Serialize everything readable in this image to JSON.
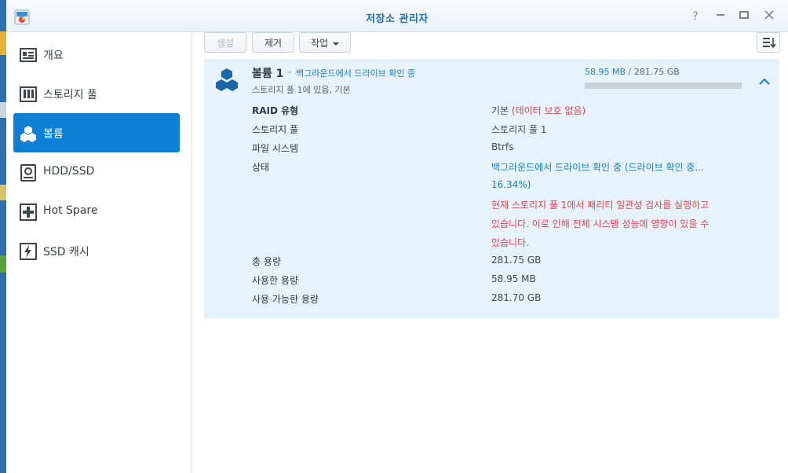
{
  "window": {
    "title": "저장소 관리자"
  },
  "titlebar_buttons": [
    "help-button",
    "minimize-button",
    "maximize-button",
    "close-button"
  ],
  "sidebar": {
    "items": [
      {
        "label": "개요",
        "icon": "overview-icon",
        "active": false
      },
      {
        "label": "스토리지 풀",
        "icon": "storage-pool-icon",
        "active": false
      },
      {
        "label": "볼륨",
        "icon": "volume-icon",
        "active": true
      },
      {
        "label": "HDD/SSD",
        "icon": "drive-icon",
        "active": false
      },
      {
        "label": "Hot Spare",
        "icon": "hot-spare-icon",
        "active": false
      },
      {
        "label": "SSD 캐시",
        "icon": "ssd-cache-icon",
        "active": false
      }
    ]
  },
  "toolbar": {
    "create_label": "생성",
    "remove_label": "제거",
    "action_label": "작업"
  },
  "volume": {
    "name": "볼륨 1",
    "dash": "-",
    "status": "백그라운드에서 드라이브 확인 중",
    "subtitle": "스토리지 풀 1에 있음, 기본",
    "used": "58.95 MB",
    "separator": "/",
    "total": "281.75 GB",
    "usage_fraction": 0.0002,
    "details": {
      "raid_label": "RAID 유형",
      "raid_value": "기본",
      "raid_note": "(데이터 보호 없음)",
      "pool_label": "스토리지 풀",
      "pool_value": "스토리지 풀 1",
      "fs_label": "파일 시스템",
      "fs_value": "Btrfs",
      "state_label": "상태",
      "state_line1": "백그라운드에서 드라이브 확인 중 (드라이브 확인 중...",
      "state_line2": "16.34%)",
      "warn_line1": "현재 스토리지 풀 1에서 패리티 일관성 검사를 실행하고",
      "warn_line2": "있습니다. 이로 인해 전체 시스템 성능에 영향이 있을 수",
      "warn_line3": "있습니다.",
      "total_label": "총 용량",
      "total_value": "281.75 GB",
      "used_label": "사용한 용량",
      "used_value": "58.95 MB",
      "avail_label": "사용 가능한 용량",
      "avail_value": "281.70 GB"
    }
  },
  "colors": {
    "accent": "#0e7fd2",
    "panel_bg": "#e6f3fc",
    "status_blue": "#1a7fbf",
    "warning_red": "#e0464a"
  }
}
